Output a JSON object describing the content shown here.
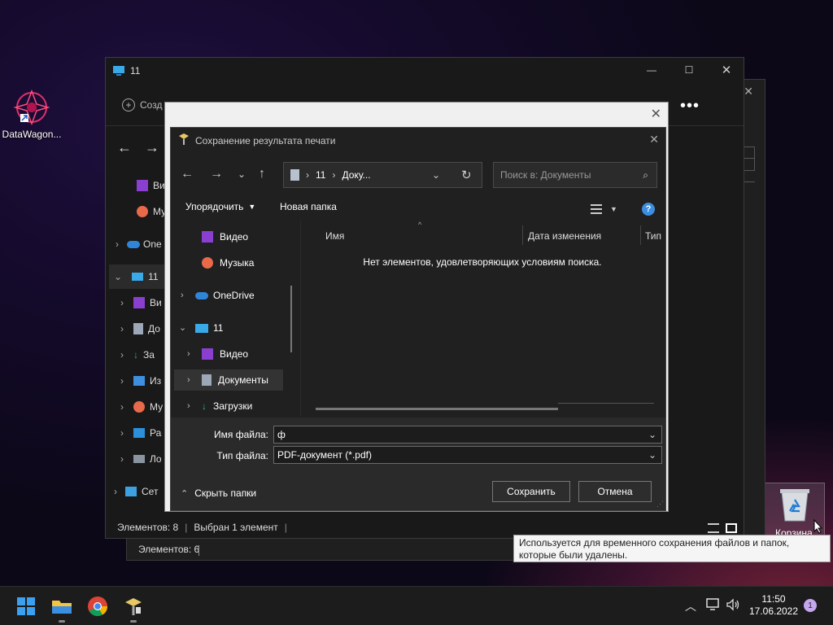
{
  "desktop": {
    "app_label": "DataWagon...",
    "recycle_label": "Корзина",
    "tooltip": "Используется для временного сохранения файлов и папок, которые были удалены."
  },
  "back_window": {
    "status_count": "Элементов: 6"
  },
  "explorer": {
    "title": "11",
    "create_label": "Созд",
    "sidebar": [
      "Ви",
      "Му",
      "One",
      "11",
      "Ви",
      "До",
      "За",
      "Из",
      "Му",
      "Ра",
      "Ло",
      "Сет"
    ],
    "status_count": "Элементов: 8",
    "status_selected": "Выбран 1 элемент"
  },
  "dialog": {
    "title": "Сохранение результата печати",
    "address_root": "11",
    "address_current": "Доку...",
    "search_placeholder": "Поиск в: Документы",
    "organize_label": "Упорядочить",
    "new_folder_label": "Новая папка",
    "tree": [
      {
        "label": "Видео",
        "icon": "video-icon"
      },
      {
        "label": "Музыка",
        "icon": "music-icon"
      },
      {
        "label": "OneDrive",
        "icon": "cloud-icon"
      },
      {
        "label": "11",
        "icon": "computer-icon"
      },
      {
        "label": "Видео",
        "icon": "video-icon"
      },
      {
        "label": "Документы",
        "icon": "document-icon"
      },
      {
        "label": "Загрузки",
        "icon": "download-icon"
      }
    ],
    "columns": [
      "Имя",
      "Дата изменения",
      "Тип"
    ],
    "empty_message": "Нет элементов, удовлетворяющих условиям поиска.",
    "filename_label": "Имя файла:",
    "filename_value": "ф",
    "filetype_label": "Тип файла:",
    "filetype_value": "PDF-документ (*.pdf)",
    "hide_folders_label": "Скрыть папки",
    "save_label": "Сохранить",
    "cancel_label": "Отмена"
  },
  "taskbar": {
    "time": "11:50",
    "date": "17.06.2022",
    "notifications": "1"
  },
  "colors": {
    "accent": "#4c9ae8",
    "help": "#3b8ee0",
    "folder": "#f4c542"
  }
}
